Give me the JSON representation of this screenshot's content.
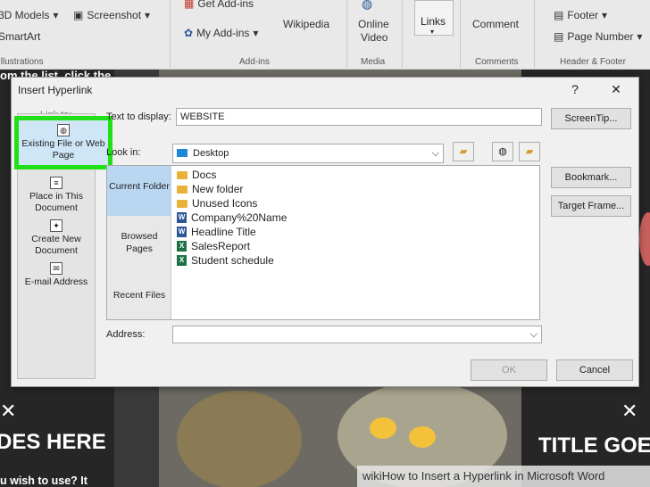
{
  "ribbon": {
    "models": "3D Models",
    "screenshot": "Screenshot",
    "smartart": "SmartArt",
    "illustrations": "Illustrations",
    "get_addins": "Get Add-ins",
    "my_addins": "My Add-ins",
    "wikipedia": "Wikipedia",
    "addins_group": "Add-ins",
    "online_video_1": "Online",
    "online_video_2": "Video",
    "media_group": "Media",
    "links": "Links",
    "comment": "Comment",
    "comments_group": "Comments",
    "footer": "Footer",
    "page_number": "Page Number",
    "header_footer_group": "Header & Footer"
  },
  "background": {
    "left_text_1": "om the list, click the",
    "left_big": "DES HERE",
    "left_bottom": "u wish to use?  It",
    "right_big": "TITLE GOE"
  },
  "dialog": {
    "title": "Insert Hyperlink",
    "help": "?",
    "close": "✕",
    "link_to": "Link to:",
    "text_to_display_label": "Text to display:",
    "text_to_display_value": "WEBSITE",
    "screentip": "ScreenTip...",
    "look_in_label": "Look in:",
    "look_in_value": "Desktop",
    "bookmark": "Bookmark...",
    "target_frame": "Target Frame...",
    "address_label": "Address:",
    "address_value": "",
    "ok": "OK",
    "cancel": "Cancel",
    "link_options": [
      "Existing File or Web Page",
      "Place in This Document",
      "Create New Document",
      "E-mail Address"
    ],
    "look_options": [
      "Current Folder",
      "Browsed Pages",
      "Recent Files"
    ],
    "files": [
      {
        "name": "Docs",
        "type": "folder"
      },
      {
        "name": "New folder",
        "type": "folder"
      },
      {
        "name": "Unused Icons",
        "type": "folder"
      },
      {
        "name": "Company%20Name",
        "type": "word"
      },
      {
        "name": "Headline Title",
        "type": "word"
      },
      {
        "name": "SalesReport",
        "type": "excel"
      },
      {
        "name": "Student schedule",
        "type": "excel"
      }
    ]
  },
  "watermark": "wikiHow to Insert a Hyperlink in Microsoft Word",
  "colors": {
    "highlight": "#22e018",
    "selection": "#cfe6f7"
  }
}
